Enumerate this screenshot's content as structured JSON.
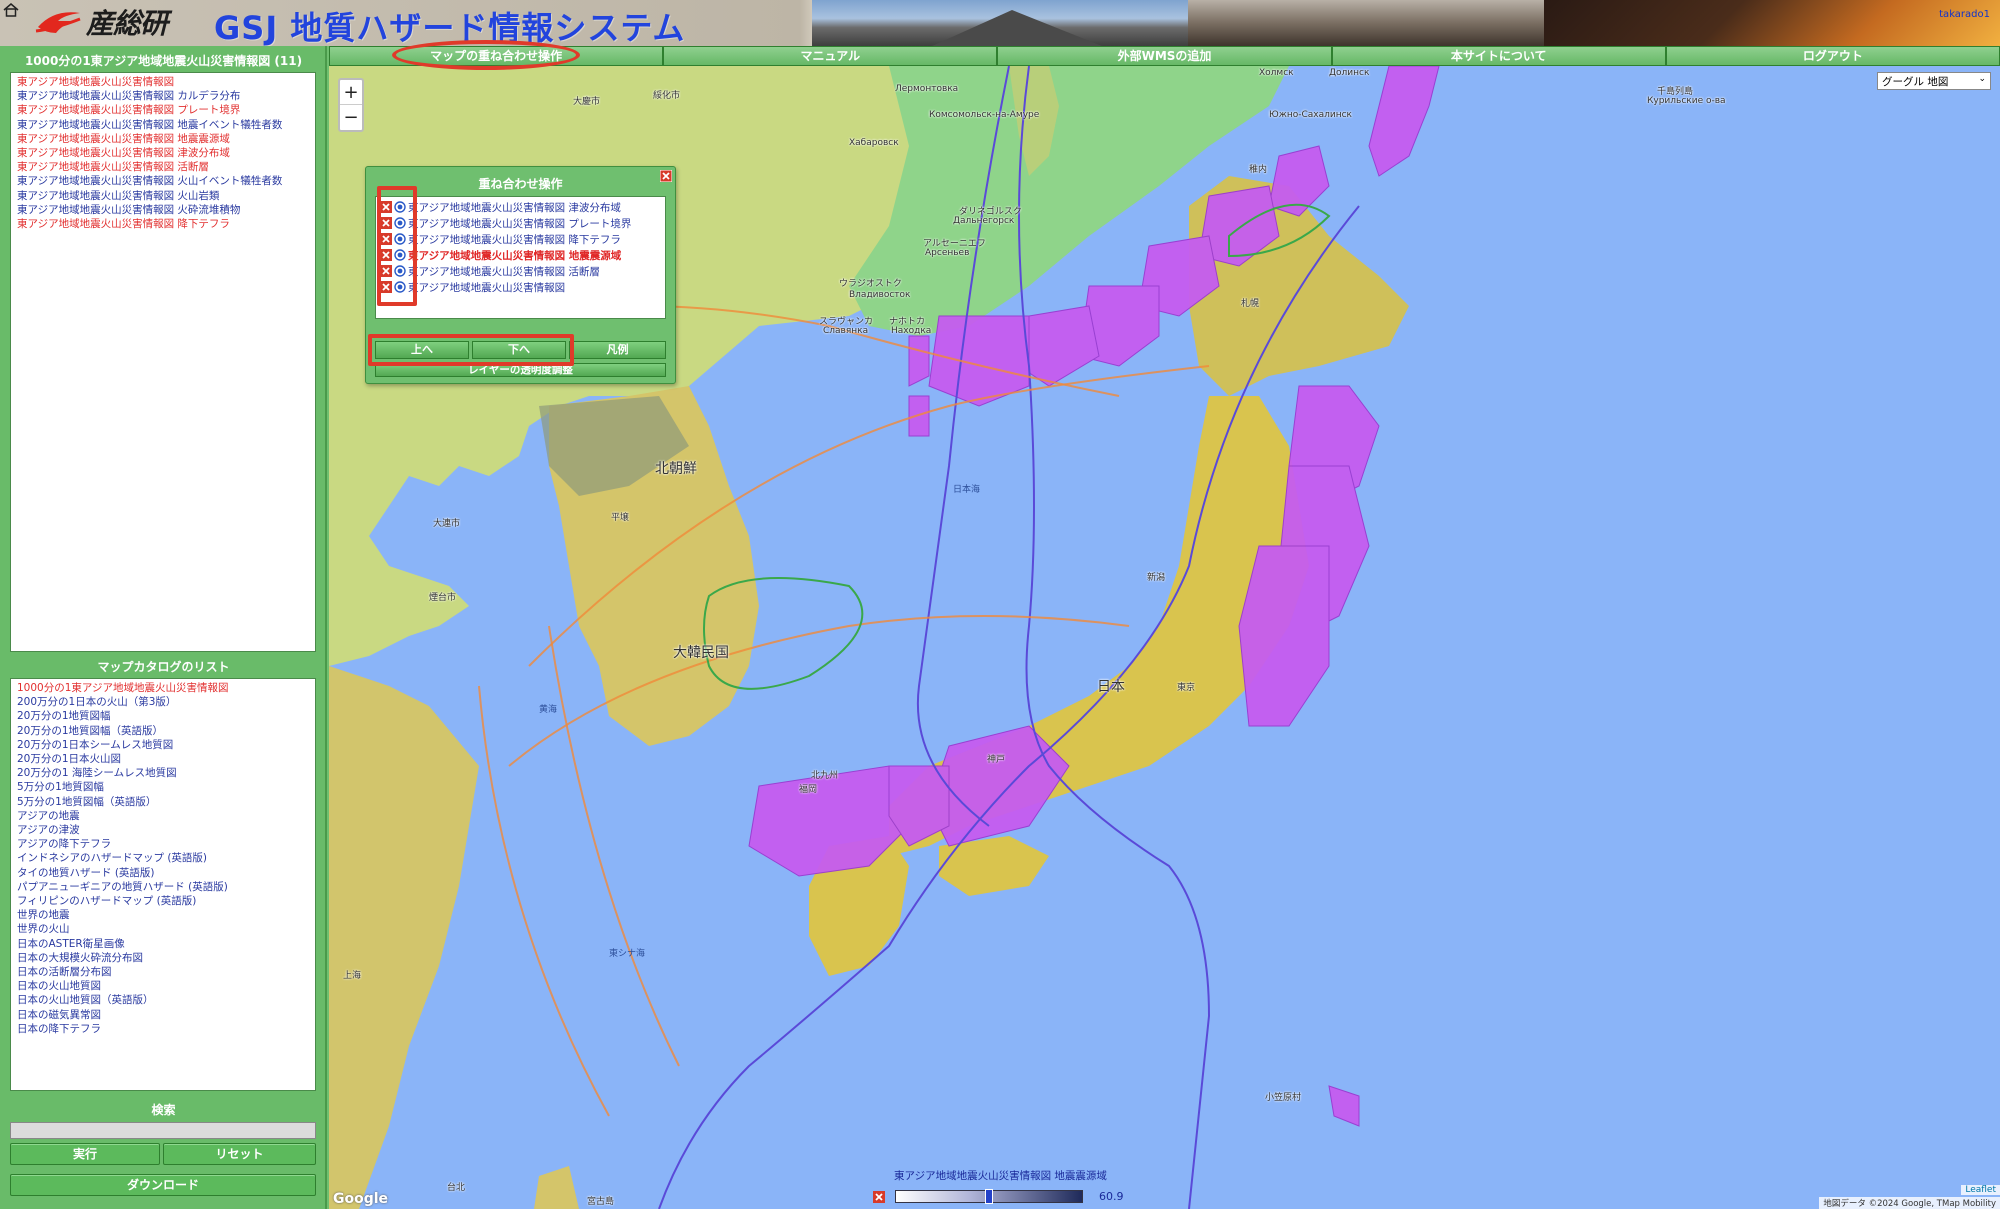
{
  "header": {
    "logo_text": "産総研",
    "site_title": "GSJ 地質ハザード情報システム",
    "user": "takarado1"
  },
  "nav": [
    {
      "label": "マップの重ね合わせ操作"
    },
    {
      "label": "マニュアル"
    },
    {
      "label": "外部WMSの追加"
    },
    {
      "label": "本サイトについて"
    },
    {
      "label": "ログアウト"
    }
  ],
  "layers_panel": {
    "title": "1000分の1東アジア地域地震火山災害情報図 (11)",
    "items": [
      {
        "label": "東アジア地域地震火山災害情報図",
        "color": "#e23030"
      },
      {
        "label": "東アジア地域地震火山災害情報図 カルデラ分布",
        "color": "#2a3aa0"
      },
      {
        "label": "東アジア地域地震火山災害情報図 プレート境界",
        "color": "#e23030"
      },
      {
        "label": "東アジア地域地震火山災害情報図 地震イベント犠牲者数",
        "color": "#2a3aa0"
      },
      {
        "label": "東アジア地域地震火山災害情報図 地震震源域",
        "color": "#e23030"
      },
      {
        "label": "東アジア地域地震火山災害情報図 津波分布域",
        "color": "#e23030"
      },
      {
        "label": "東アジア地域地震火山災害情報図 活断層",
        "color": "#e23030"
      },
      {
        "label": "東アジア地域地震火山災害情報図 火山イベント犠牲者数",
        "color": "#2a3aa0"
      },
      {
        "label": "東アジア地域地震火山災害情報図 火山岩類",
        "color": "#2a3aa0"
      },
      {
        "label": "東アジア地域地震火山災害情報図 火砕流堆積物",
        "color": "#2a3aa0"
      },
      {
        "label": "東アジア地域地震火山災害情報図 降下テフラ",
        "color": "#e23030"
      }
    ]
  },
  "catalog": {
    "title": "マップカタログのリスト",
    "items": [
      {
        "label": "1000分の1東アジア地域地震火山災害情報図",
        "color": "#e23030"
      },
      {
        "label": "200万分の1日本の火山（第3版）",
        "color": "#2a3aa0"
      },
      {
        "label": "20万分の1地質図幅",
        "color": "#2a3aa0"
      },
      {
        "label": "20万分の1地質図幅（英語版）",
        "color": "#2a3aa0"
      },
      {
        "label": "20万分の1日本シームレス地質図",
        "color": "#2a3aa0"
      },
      {
        "label": "20万分の1日本火山図",
        "color": "#2a3aa0"
      },
      {
        "label": "20万分の1 海陸シームレス地質図",
        "color": "#2a3aa0"
      },
      {
        "label": "5万分の1地質図幅",
        "color": "#2a3aa0"
      },
      {
        "label": "5万分の1地質図幅（英語版）",
        "color": "#2a3aa0"
      },
      {
        "label": "アジアの地震",
        "color": "#2a3aa0"
      },
      {
        "label": "アジアの津波",
        "color": "#2a3aa0"
      },
      {
        "label": "アジアの降下テフラ",
        "color": "#2a3aa0"
      },
      {
        "label": "インドネシアのハザードマップ (英語版)",
        "color": "#2a3aa0"
      },
      {
        "label": "タイの地質ハザード (英語版)",
        "color": "#2a3aa0"
      },
      {
        "label": "パプアニューギニアの地質ハザード (英語版)",
        "color": "#2a3aa0"
      },
      {
        "label": "フィリピンのハザードマップ (英語版)",
        "color": "#2a3aa0"
      },
      {
        "label": "世界の地震",
        "color": "#2a3aa0"
      },
      {
        "label": "世界の火山",
        "color": "#2a3aa0"
      },
      {
        "label": "日本のASTER衛星画像",
        "color": "#2a3aa0"
      },
      {
        "label": "日本の大規模火砕流分布図",
        "color": "#2a3aa0"
      },
      {
        "label": "日本の活断層分布図",
        "color": "#2a3aa0"
      },
      {
        "label": "日本の火山地質図",
        "color": "#2a3aa0"
      },
      {
        "label": "日本の火山地質図（英語版）",
        "color": "#2a3aa0"
      },
      {
        "label": "日本の磁気異常図",
        "color": "#2a3aa0"
      },
      {
        "label": "日本の降下テフラ",
        "color": "#2a3aa0"
      }
    ]
  },
  "search": {
    "title": "検索",
    "value": "",
    "run_label": "実行",
    "reset_label": "リセット",
    "download_label": "ダウンロード"
  },
  "map": {
    "basemap": "グーグル 地図",
    "zoom_in": "+",
    "zoom_out": "−",
    "leaflet": "Leaflet",
    "attribution": "地図データ ©2024 Google, TMap Mobility",
    "google": "Google",
    "places": [
      {
        "label": "大慶市"
      },
      {
        "label": "綏化市"
      },
      {
        "label": "Лермонтовка"
      },
      {
        "label": "Хабаровск"
      },
      {
        "label": "Комсомольск-на-Амуре"
      },
      {
        "label": "Холмск"
      },
      {
        "label": "Долинск"
      },
      {
        "label": "Южно-Сахалинск"
      },
      {
        "label": "千島列島"
      },
      {
        "label": "Курильские о-ва"
      },
      {
        "label": "ウラジオストク"
      },
      {
        "label": "Владивосток"
      },
      {
        "label": "ナホトカ"
      },
      {
        "label": "Находка"
      },
      {
        "label": "スラヴャンカ"
      },
      {
        "label": "Славянка"
      },
      {
        "label": "ダリネゴルスク"
      },
      {
        "label": "Дальнегорск"
      },
      {
        "label": "アルセーニエフ"
      },
      {
        "label": "Арсеньев"
      },
      {
        "label": "稚内"
      },
      {
        "label": "札幌"
      },
      {
        "label": "北朝鮮"
      },
      {
        "label": "平壌"
      },
      {
        "label": "大連市"
      },
      {
        "label": "煙台市"
      },
      {
        "label": "大韓民国"
      },
      {
        "label": "日本海"
      },
      {
        "label": "新潟"
      },
      {
        "label": "日本"
      },
      {
        "label": "東京"
      },
      {
        "label": "神戸"
      },
      {
        "label": "福岡"
      },
      {
        "label": "北九州"
      },
      {
        "label": "上海"
      },
      {
        "label": "東シナ海"
      },
      {
        "label": "黄海"
      },
      {
        "label": "小笠原村"
      },
      {
        "label": "宮古島"
      },
      {
        "label": "台北"
      }
    ]
  },
  "opacity": {
    "layer": "東アジア地域地震火山災害情報図 地震震源域",
    "value_text": "60.9",
    "value": 0.5
  },
  "dialog": {
    "title": "重ね合わせ操作",
    "rows": [
      {
        "label": "東アジア地域地震火山災害情報図 津波分布域",
        "selected": false
      },
      {
        "label": "東アジア地域地震火山災害情報図 プレート境界",
        "selected": false
      },
      {
        "label": "東アジア地域地震火山災害情報図 降下テフラ",
        "selected": false
      },
      {
        "label": "東アジア地域地震火山災害情報図 地震震源域",
        "selected": true
      },
      {
        "label": "東アジア地域地震火山災害情報図 活断層",
        "selected": false
      },
      {
        "label": "東アジア地域地震火山災害情報図",
        "selected": false
      }
    ],
    "up_label": "上へ",
    "down_label": "下へ",
    "legend_label": "凡例",
    "opacity_label": "レイヤーの透明度調整"
  },
  "colors": {
    "panel_green": "#69bb69",
    "sea": "#8ab4f8",
    "hazard_purple": "#c55cf0",
    "annotation_red": "#e03a2a"
  }
}
